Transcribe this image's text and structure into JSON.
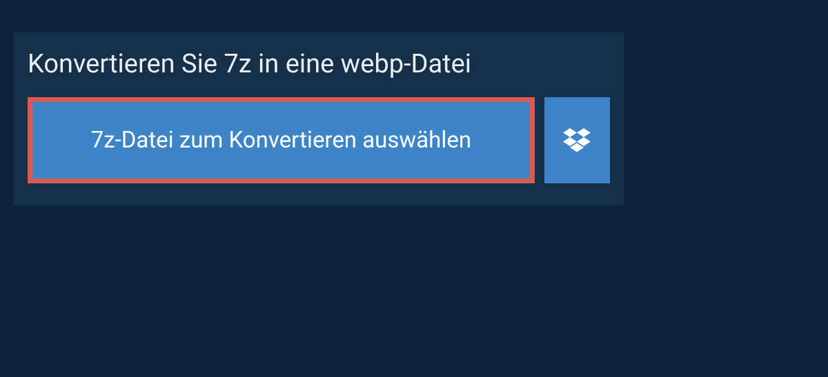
{
  "heading": "Konvertieren Sie 7z in eine webp-Datei",
  "buttons": {
    "select_file_label": "7z-Datei zum Konvertieren auswählen"
  },
  "colors": {
    "background": "#0c2238",
    "panel": "#153048",
    "button": "#3d85c6",
    "highlight_border": "#d65b55",
    "text_light": "#e8eef3",
    "button_text": "#ffffff"
  }
}
